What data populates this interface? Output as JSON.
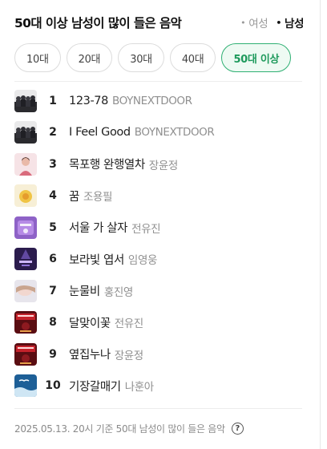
{
  "header": {
    "title": "50대 이상 남성이 많이 들은 음악",
    "gender_options": [
      {
        "label": "여성",
        "active": false
      },
      {
        "label": "남성",
        "active": true
      }
    ],
    "dot": "•"
  },
  "tabs": [
    "10대",
    "20대",
    "30대",
    "40대",
    "50대 이상"
  ],
  "active_tab": "50대 이상",
  "songs": [
    {
      "rank": "1",
      "title": "123-78",
      "artist": "BOYNEXTDOOR",
      "thumb": "band-photo"
    },
    {
      "rank": "2",
      "title": "I Feel Good",
      "artist": "BOYNEXTDOOR",
      "thumb": "band-photo"
    },
    {
      "rank": "3",
      "title": "목포행 완행열차",
      "artist": "장윤정",
      "thumb": "portrait-pink"
    },
    {
      "rank": "4",
      "title": "꿈",
      "artist": "조용필",
      "thumb": "sun-cover"
    },
    {
      "rank": "5",
      "title": "서울 가 살자",
      "artist": "전유진",
      "thumb": "purple-cover"
    },
    {
      "rank": "6",
      "title": "보라빛 엽서",
      "artist": "임영웅",
      "thumb": "stage-cover"
    },
    {
      "rank": "7",
      "title": "눈물비",
      "artist": "홍진영",
      "thumb": "light-portrait"
    },
    {
      "rank": "8",
      "title": "달맞이꽃",
      "artist": "전유진",
      "thumb": "red-poster"
    },
    {
      "rank": "9",
      "title": "옆집누나",
      "artist": "장윤정",
      "thumb": "red-poster"
    },
    {
      "rank": "10",
      "title": "기장갈매기",
      "artist": "나훈아",
      "thumb": "blue-sea"
    }
  ],
  "footer": {
    "text": "2025.05.13. 20시 기준 50대 남성이 많이 들은 음악",
    "help_symbol": "?"
  },
  "colors": {
    "accent": "#2fb073",
    "accent_bg": "#eefaf3",
    "muted": "#8f8f8f"
  }
}
